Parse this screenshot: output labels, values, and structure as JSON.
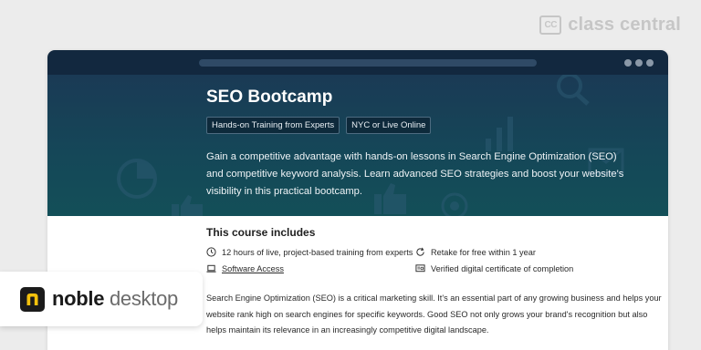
{
  "watermark": {
    "box_text": "CC",
    "text": "class central"
  },
  "browser": {
    "dots": 3
  },
  "hero": {
    "title": "SEO Bootcamp",
    "tags": [
      "Hands-on Training from Experts",
      "NYC or Live Online"
    ],
    "description": "Gain a competitive advantage with hands-on lessons in Search Engine Optimization (SEO) and competitive keyword analysis. Learn advanced SEO strategies and boost your website's visibility in this practical bootcamp."
  },
  "includes": {
    "title": "This course includes",
    "items": [
      {
        "icon": "clock-icon",
        "text": "12 hours of live, project-based training from experts"
      },
      {
        "icon": "refresh-icon",
        "text": "Retake for free within 1 year"
      },
      {
        "icon": "laptop-icon",
        "text": "Software Access"
      },
      {
        "icon": "certificate-icon",
        "text": "Verified digital certificate of completion"
      }
    ]
  },
  "body": {
    "text": "Search Engine Optimization (SEO) is a critical marketing skill. It's an essential part of any growing business and helps your website rank high on search engines for specific keywords. Good SEO not only grows your brand's recognition but also helps maintain its relevance in an increasingly competitive digital landscape."
  },
  "brand": {
    "part1": "noble",
    "part2": " desktop",
    "mark": "n"
  },
  "colors": {
    "hero_top": "#1a3a55",
    "hero_bottom": "#134f58",
    "topbar": "#12283f",
    "brand_mark": "#f4c20d"
  }
}
